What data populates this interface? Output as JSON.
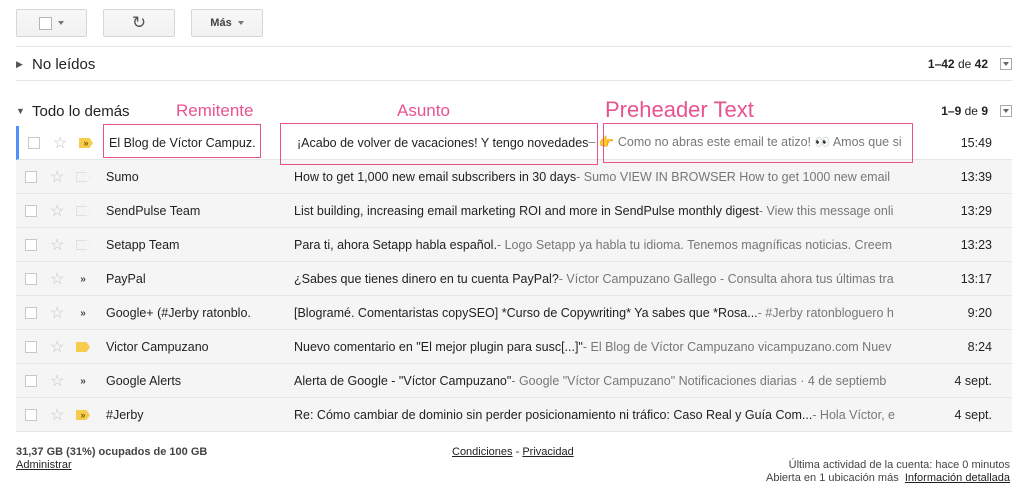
{
  "toolbar": {
    "refresh_glyph": "↻",
    "more_label": "Más"
  },
  "unread_section": {
    "title": "No leídos",
    "range": "1–42",
    "of_word": "de",
    "total": "42"
  },
  "other_section": {
    "title": "Todo lo demás",
    "range": "1–9",
    "of_word": "de",
    "total": "9"
  },
  "annotations": {
    "sender": "Remitente",
    "subject": "Asunto",
    "preheader": "Preheader Text",
    "color": "#e8538f"
  },
  "messages": [
    {
      "sender": "El Blog de Víctor Campuz.",
      "subject": "¡Acabo de volver de vacaciones! Y tengo novedades",
      "snippet": " – 👉 Como no abras este email te atizo! 👀 Amos que si",
      "time": "15:49",
      "importance": "yellow",
      "unread": true
    },
    {
      "sender": "Sumo",
      "subject": "How to get 1,000 new email subscribers in 30 days",
      "snippet": " - Sumo VIEW IN BROWSER How to get 1000 new email",
      "time": "13:39",
      "importance": "plain",
      "unread": false
    },
    {
      "sender": "SendPulse Team",
      "subject": "List building, increasing email marketing ROI and more in SendPulse monthly digest",
      "snippet": " - View this message onli",
      "time": "13:29",
      "importance": "plain",
      "unread": false
    },
    {
      "sender": "Setapp Team",
      "subject": "Para ti, ahora Setapp habla español.",
      "snippet": " - Logo Setapp ya habla tu idioma. Tenemos magníficas noticias. Creem",
      "time": "13:23",
      "importance": "plain",
      "unread": false
    },
    {
      "sender": "PayPal",
      "subject": "¿Sabes que tienes dinero en tu cuenta PayPal?",
      "snippet": " - Víctor Campuzano Gallego - Consulta ahora tus últimas tra",
      "time": "13:17",
      "importance": "arrow",
      "unread": false
    },
    {
      "sender": "Google+ (#Jerby ratonblo.",
      "subject": "[Blogramé. Comentaristas copySEO] *Curso de Copywriting* Ya sabes que *Rosa...",
      "snippet": " - #Jerby ratonbloguero h",
      "time": "9:20",
      "importance": "arrow",
      "unread": false
    },
    {
      "sender": "Victor Campuzano",
      "subject": "Nuevo comentario en \"El mejor plugin para susc[...]\"",
      "snippet": " - El Blog de Víctor Campuzano vicampuzano.com Nuev",
      "time": "8:24",
      "importance": "yellow-plain",
      "unread": false
    },
    {
      "sender": "Google Alerts",
      "subject": "Alerta de Google - \"Víctor Campuzano\"",
      "snippet": " - Google \"Víctor Campuzano\" Notificaciones diarias · 4 de septiemb",
      "time": "4 sept.",
      "importance": "arrow",
      "unread": false
    },
    {
      "sender": "#Jerby",
      "subject": "Re: Cómo cambiar de dominio sin perder posicionamiento ni tráfico: Caso Real y Guía Com...",
      "snippet": " - Hola Víctor, e",
      "time": "4 sept.",
      "importance": "yellow",
      "unread": false
    }
  ],
  "footer": {
    "quota": "31,37 GB (31%) ocupados de 100 GB",
    "admin": "Administrar",
    "terms": "Condiciones",
    "separator": " - ",
    "privacy": "Privacidad",
    "last_activity": "Última actividad de la cuenta: hace 0 minutos",
    "open_in": "Abierta en 1 ubicación más",
    "details": "Información detallada"
  }
}
